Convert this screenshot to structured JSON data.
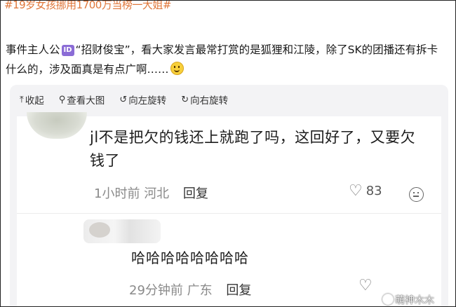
{
  "post": {
    "hashtag": "#19岁女孩挪用1700万当榜一大姐#",
    "text_before_badge": "事件主人公",
    "badge": "ID",
    "text_after_badge": "“招财俊宝”，看大家发言最常打赏的是狐狸和江陵，除了SK的团播还有拆卡什么的，涉及面真是有点广啊……",
    "emoji": "smile-emoji"
  },
  "toolbar": {
    "collapse": "收起",
    "view_large": "查看大图",
    "rotate_left": "向左旋转",
    "rotate_right": "向右旋转"
  },
  "comments": [
    {
      "text": "jl不是把欠的钱还上就跑了吗，这回好了，又要欠钱了",
      "time": "1小时前",
      "location": "河北",
      "reply": "回复",
      "likes": "83"
    },
    {
      "text": "哈哈哈哈哈哈哈哈",
      "time": "29分钟前",
      "location": "广东",
      "reply": "回复"
    }
  ],
  "watermark": "萌神木木"
}
